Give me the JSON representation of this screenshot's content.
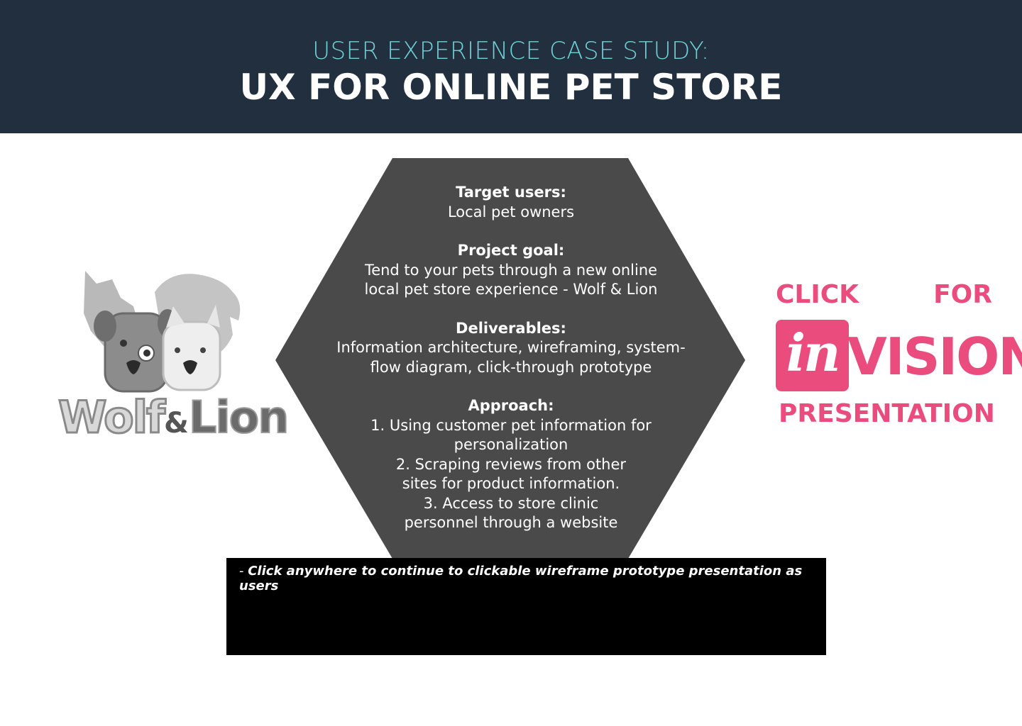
{
  "header": {
    "subtitle": "USER EXPERIENCE CASE STUDY:",
    "title": "UX FOR ONLINE PET STORE"
  },
  "logo": {
    "wordmark_left": "Wolf",
    "wordmark_amp": "&",
    "wordmark_right": "Lion"
  },
  "hexagon": {
    "target_heading": "Target users:",
    "target_text": "Local pet owners",
    "goal_heading": "Project goal:",
    "goal_line1": "Tend to your pets through a new online",
    "goal_line2": "local pet store experience - Wolf & Lion",
    "deliverables_heading": "Deliverables:",
    "deliverables_line1": "Information architecture, wireframing, system-",
    "deliverables_line2": "flow diagram, click-through prototype",
    "approach_heading": "Approach:",
    "approach_lines": [
      "1. Using customer pet information for",
      "personalization",
      "2. Scraping reviews from other",
      "sites for product information.",
      "3. Access to store clinic",
      "personnel through a website"
    ]
  },
  "invision": {
    "click": "CLICK",
    "for": "FOR",
    "badge": "in",
    "vision": "VISION",
    "presentation": "PRESENTATION",
    "color": "#ea4c7e"
  },
  "caption": {
    "dash": "- ",
    "text": "Click anywhere to continue to clickable wireframe prototype presentation as users"
  },
  "colors": {
    "header_bg": "#222f3f",
    "subtitle": "#6fd1d6",
    "hexagon": "#4a4a4a"
  }
}
